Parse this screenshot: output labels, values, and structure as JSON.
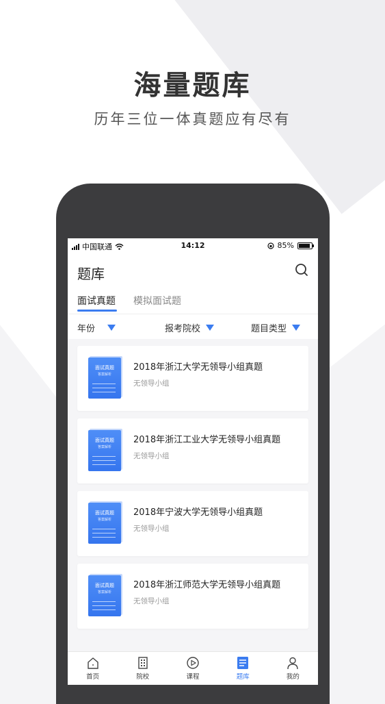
{
  "promo": {
    "headline": "海量题库",
    "subline": "历年三位一体真题应有尽有"
  },
  "status_bar": {
    "carrier": "中国联通",
    "time": "14:12",
    "battery": "85%"
  },
  "navbar": {
    "title": "题库",
    "search_icon": "search-icon"
  },
  "tabs": [
    {
      "label": "面试真题",
      "active": true
    },
    {
      "label": "模拟面试题",
      "active": false
    }
  ],
  "filters": [
    {
      "label": "年份"
    },
    {
      "label": "报考院校"
    },
    {
      "label": "题目类型"
    }
  ],
  "cover": {
    "title": "面试真题",
    "subtitle": "答案解析"
  },
  "questions": [
    {
      "title": "2018年浙江大学无领导小组真题",
      "tag": "无领导小组"
    },
    {
      "title": "2018年浙江工业大学无领导小组真题",
      "tag": "无领导小组"
    },
    {
      "title": "2018年宁波大学无领导小组真题",
      "tag": "无领导小组"
    },
    {
      "title": "2018年浙江师范大学无领导小组真题",
      "tag": "无领导小组"
    }
  ],
  "tabbar": [
    {
      "label": "首页",
      "icon": "home-icon",
      "active": false
    },
    {
      "label": "院校",
      "icon": "building-icon",
      "active": false
    },
    {
      "label": "课程",
      "icon": "play-icon",
      "active": false
    },
    {
      "label": "题库",
      "icon": "question-bank-icon",
      "active": true
    },
    {
      "label": "我的",
      "icon": "person-icon",
      "active": false
    }
  ],
  "colors": {
    "accent": "#3b7cf0",
    "phone_frame": "#3c3c3e"
  }
}
